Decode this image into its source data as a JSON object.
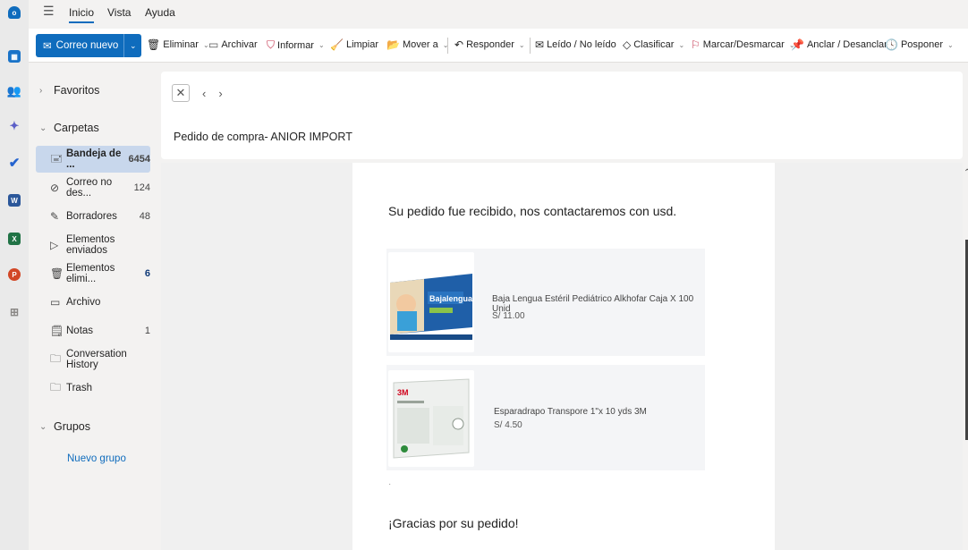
{
  "rail": {
    "apps": [
      {
        "name": "outlook-icon",
        "color": "#0f6cbd"
      },
      {
        "name": "calendar-icon",
        "color": "#1a73c8"
      },
      {
        "name": "people-icon",
        "color": "#2b88d8"
      },
      {
        "name": "teams-icon",
        "color": "#5b5fc7"
      },
      {
        "name": "todo-icon",
        "color": "#2564cf"
      },
      {
        "name": "word-icon",
        "color": "#2b579a"
      },
      {
        "name": "excel-icon",
        "color": "#217346"
      },
      {
        "name": "powerpoint-icon",
        "color": "#d24726"
      },
      {
        "name": "apps-icon",
        "color": "#8a8886"
      }
    ]
  },
  "menu": {
    "tabs": [
      "Inicio",
      "Vista",
      "Ayuda"
    ]
  },
  "ribbon": {
    "new_mail": "Correo nuevo",
    "delete": "Eliminar",
    "archive": "Archivar",
    "report": "Informar",
    "sweep": "Limpiar",
    "move": "Mover a",
    "reply": "Responder",
    "read_unread": "Leído / No leído",
    "categorize": "Clasificar",
    "flag": "Marcar/Desmarcar",
    "pin": "Anclar / Desanclar",
    "snooze": "Posponer"
  },
  "folders": {
    "favorites": "Favoritos",
    "folders_heading": "Carpetas",
    "items": [
      {
        "label": "Bandeja de ...",
        "count": "6454"
      },
      {
        "label": "Correo no des...",
        "count": "124"
      },
      {
        "label": "Borradores",
        "count": "48"
      },
      {
        "label": "Elementos enviados",
        "count": ""
      },
      {
        "label": "Elementos elimi...",
        "count": "6"
      },
      {
        "label": "Archivo",
        "count": ""
      },
      {
        "label": "Notas",
        "count": "1"
      },
      {
        "label": "Conversation History",
        "count": ""
      },
      {
        "label": "Trash",
        "count": ""
      }
    ],
    "groups_heading": "Grupos",
    "new_group": "Nuevo grupo"
  },
  "message": {
    "subject": "Pedido de compra- ANIOR IMPORT",
    "intro": "Su pedido fue recibido, nos contactaremos con usd.",
    "products": [
      {
        "name": "Baja Lengua Estéril Pediátrico Alkhofar Caja X 100 Unid",
        "price": "S/ 11.00",
        "image_label": "Bajalengua"
      },
      {
        "name": "Esparadrapo Transpore 1\"x 10 yds 3M",
        "price": "S/ 4.50",
        "image_label": "3M"
      }
    ],
    "thanks": "¡Gracias por su pedido!"
  }
}
